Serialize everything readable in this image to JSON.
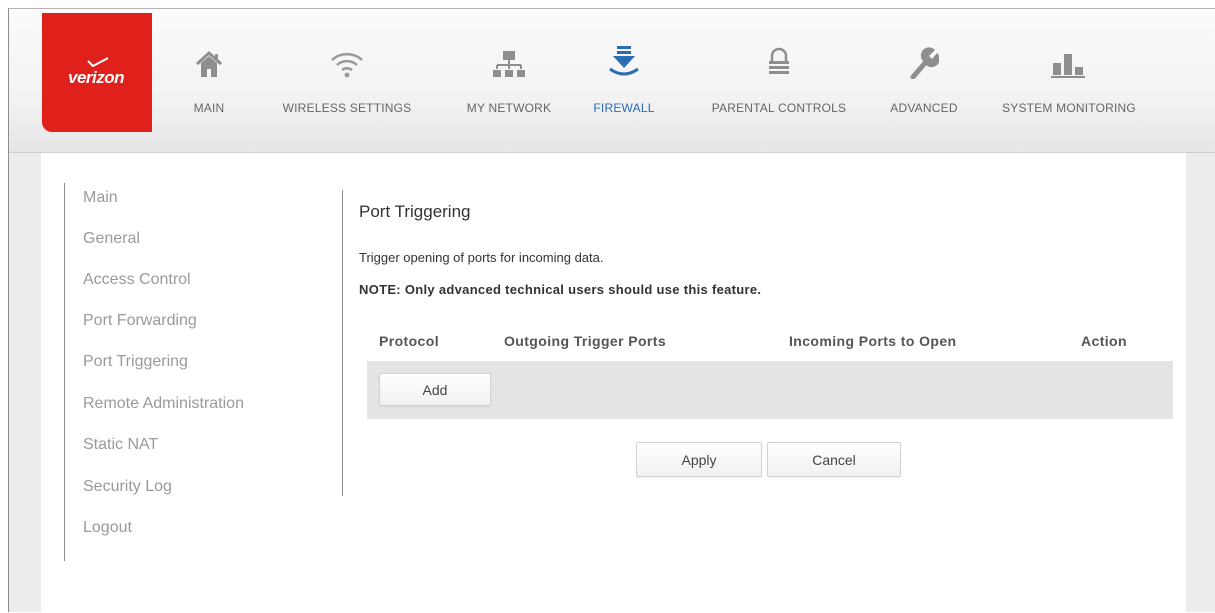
{
  "brand": {
    "logo_text": "verizon",
    "accent_color": "#e0201b",
    "active_color": "#2b6cb3"
  },
  "nav": {
    "items": [
      {
        "label": "MAIN",
        "icon": "home-icon"
      },
      {
        "label": "WIRELESS SETTINGS",
        "icon": "wifi-icon"
      },
      {
        "label": "MY NETWORK",
        "icon": "network-icon"
      },
      {
        "label": "FIREWALL",
        "icon": "firewall-icon",
        "active": true
      },
      {
        "label": "PARENTAL CONTROLS",
        "icon": "lock-icon"
      },
      {
        "label": "ADVANCED",
        "icon": "wrench-icon"
      },
      {
        "label": "SYSTEM MONITORING",
        "icon": "bar-chart-icon"
      }
    ]
  },
  "sidebar": {
    "items": [
      {
        "label": "Main"
      },
      {
        "label": "General"
      },
      {
        "label": "Access Control"
      },
      {
        "label": "Port Forwarding"
      },
      {
        "label": "Port Triggering"
      },
      {
        "label": "Remote Administration"
      },
      {
        "label": "Static NAT"
      },
      {
        "label": "Security Log"
      },
      {
        "label": "Logout"
      }
    ]
  },
  "main": {
    "title": "Port Triggering",
    "description": "Trigger opening of ports for incoming data.",
    "note": "NOTE: Only advanced technical users should use this feature.",
    "table": {
      "headers": [
        "Protocol",
        "Outgoing Trigger Ports",
        "Incoming Ports to Open",
        "Action"
      ]
    },
    "add_label": "Add",
    "apply_label": "Apply",
    "cancel_label": "Cancel"
  }
}
